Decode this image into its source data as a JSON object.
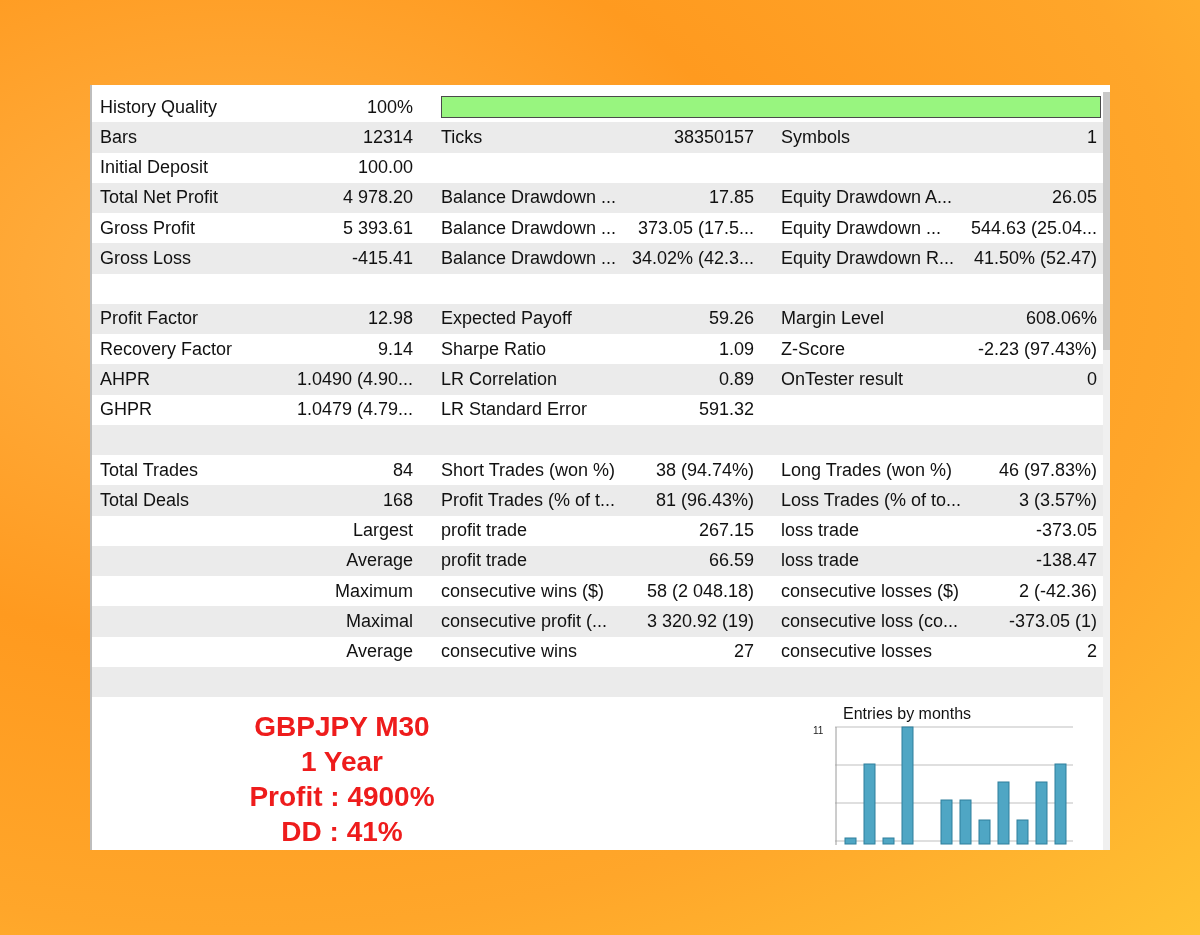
{
  "report": {
    "quality": {
      "label": "History Quality",
      "value": "100%",
      "level": 1.0
    },
    "rows": [
      {
        "kind": "stats",
        "label_1": "Bars",
        "value_1": "12314",
        "label_2": "Ticks",
        "value_2": "38350157",
        "label_3": "Symbols",
        "value_3": "1"
      },
      {
        "kind": "stats",
        "label_1": "Initial Deposit",
        "value_1": "100.00"
      },
      {
        "kind": "stats",
        "label_1": "Total Net Profit",
        "value_1": "4 978.20",
        "label_2": "Balance Drawdown ...",
        "value_2": "17.85",
        "label_3": "Equity Drawdown A...",
        "value_3": "26.05"
      },
      {
        "kind": "stats",
        "label_1": "Gross Profit",
        "value_1": "5 393.61",
        "label_2": "Balance Drawdown ...",
        "value_2": "373.05 (17.5...",
        "label_3": "Equity Drawdown ...",
        "value_3": "544.63 (25.04..."
      },
      {
        "kind": "stats",
        "label_1": "Gross Loss",
        "value_1": "-415.41",
        "label_2": "Balance Drawdown ...",
        "value_2": "34.02% (42.3...",
        "label_3": "Equity Drawdown R...",
        "value_3": "41.50% (52.47)"
      },
      {
        "kind": "spacer"
      },
      {
        "kind": "stats",
        "label_1": "Profit Factor",
        "value_1": "12.98",
        "label_2": "Expected Payoff",
        "value_2": "59.26",
        "label_3": "Margin Level",
        "value_3": "608.06%"
      },
      {
        "kind": "stats",
        "label_1": "Recovery Factor",
        "value_1": "9.14",
        "label_2": "Sharpe Ratio",
        "value_2": "1.09",
        "label_3": "Z-Score",
        "value_3": "-2.23 (97.43%)"
      },
      {
        "kind": "stats",
        "label_1": "AHPR",
        "value_1": "1.0490 (4.90...",
        "label_2": "LR Correlation",
        "value_2": "0.89",
        "label_3": "OnTester result",
        "value_3": "0"
      },
      {
        "kind": "stats",
        "label_1": "GHPR",
        "value_1": "1.0479 (4.79...",
        "label_2": "LR Standard Error",
        "value_2": "591.32"
      },
      {
        "kind": "spacer"
      },
      {
        "kind": "stats",
        "label_1": "Total Trades",
        "value_1": "84",
        "label_2": "Short Trades (won %)",
        "value_2": "38 (94.74%)",
        "label_3": "Long Trades (won %)",
        "value_3": "46 (97.83%)"
      },
      {
        "kind": "stats",
        "label_1": "Total Deals",
        "value_1": "168",
        "label_2": "Profit Trades (% of t...",
        "value_2": "81 (96.43%)",
        "label_3": "Loss Trades (% of to...",
        "value_3": "3 (3.57%)"
      },
      {
        "kind": "stats",
        "value_1": "Largest",
        "label_2": "profit trade",
        "value_2": "267.15",
        "label_3": "loss trade",
        "value_3": "-373.05"
      },
      {
        "kind": "stats",
        "value_1": "Average",
        "label_2": "profit trade",
        "value_2": "66.59",
        "label_3": "loss trade",
        "value_3": "-138.47"
      },
      {
        "kind": "stats",
        "value_1": "Maximum",
        "label_2": "consecutive wins ($)",
        "value_2": "58 (2 048.18)",
        "label_3": "consecutive losses ($)",
        "value_3": "2 (-42.36)"
      },
      {
        "kind": "stats",
        "value_1": "Maximal",
        "label_2": "consecutive profit (...",
        "value_2": "3 320.92 (19)",
        "label_3": "consecutive loss (co...",
        "value_3": "-373.05 (1)"
      },
      {
        "kind": "stats",
        "value_1": "Average",
        "label_2": "consecutive wins",
        "value_2": "27",
        "label_3": "consecutive losses",
        "value_3": "2"
      },
      {
        "kind": "spacer"
      }
    ],
    "summary_lines": [
      "GBPJPY M30",
      "1 Year",
      "Profit : 4900%",
      "DD : 41%"
    ],
    "chart": {
      "title": "Entries by months",
      "tick": "11"
    }
  }
}
